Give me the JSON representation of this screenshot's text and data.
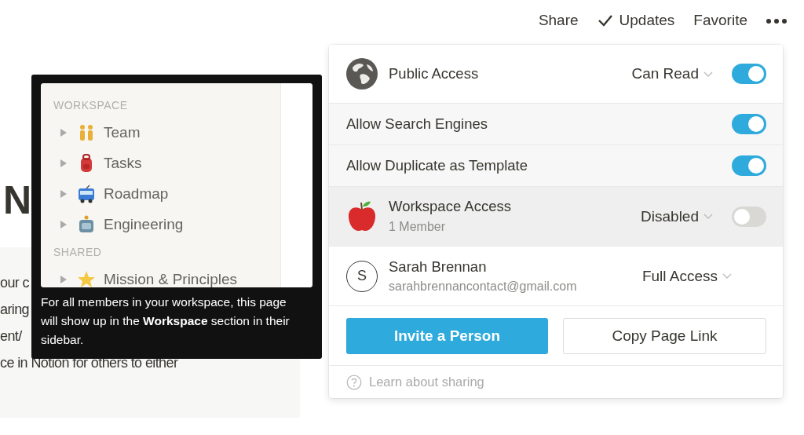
{
  "topbar": {
    "items": [
      {
        "kind": "text",
        "label": "Share"
      },
      {
        "kind": "check",
        "label": "Updates"
      },
      {
        "kind": "text",
        "label": "Favorite"
      },
      {
        "kind": "more"
      }
    ]
  },
  "page": {
    "heading": "N",
    "callout_lines": [
      "our c",
      "aring",
      "ent/",
      "ce in Notion for others to either"
    ]
  },
  "tooltip": {
    "sidebar": {
      "sections": [
        {
          "title": "WORKSPACE",
          "items": [
            {
              "label": "Team",
              "kind": "team",
              "expanded": false
            },
            {
              "label": "Tasks",
              "kind": "backpack",
              "expanded": false
            },
            {
              "label": "Roadmap",
              "kind": "bus",
              "expanded": false
            },
            {
              "label": "Engineering",
              "kind": "robot",
              "expanded": false
            }
          ]
        },
        {
          "title": "SHARED",
          "items": [
            {
              "label": "Mission & Principles",
              "kind": "star",
              "expanded": false
            }
          ]
        }
      ]
    },
    "text": "For all members in your workspace, this page will show up in the **Workspace** section in their sidebar."
  },
  "share_panel": {
    "rows": [
      {
        "kind": "public",
        "title": "Public Access",
        "permission": "Can Read",
        "on": true,
        "highlighted": false
      },
      {
        "kind": "option",
        "title": "Allow Search Engines",
        "on": true
      },
      {
        "kind": "option",
        "title": "Allow Duplicate as Template",
        "on": true
      },
      {
        "kind": "workspace",
        "title": "Workspace Access",
        "subtitle": "1 Member",
        "permission": "Disabled",
        "on": false,
        "highlighted": true
      },
      {
        "kind": "person",
        "initial": "S",
        "name": "Sarah Brennan",
        "email": "sarahbrennancontact@gmail.com",
        "permission": "Full Access"
      }
    ],
    "buttons": [
      {
        "label": "Invite a Person",
        "kind": "primary"
      },
      {
        "label": "Copy Page Link",
        "kind": "secondary"
      }
    ],
    "help": "Learn about sharing"
  }
}
